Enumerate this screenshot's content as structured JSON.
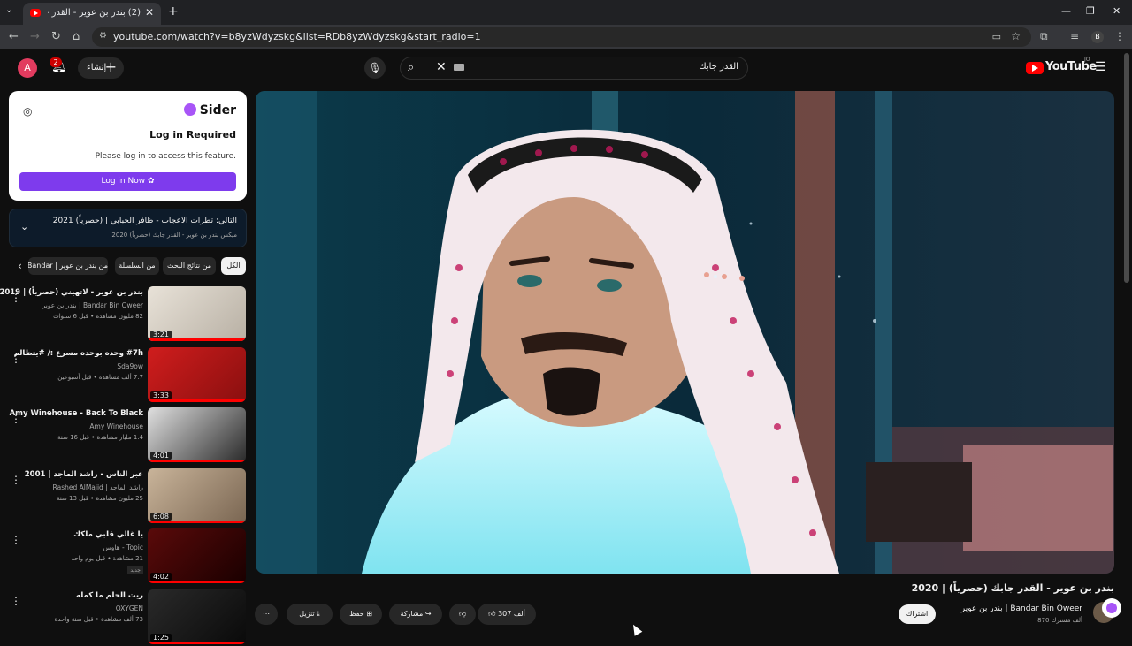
{
  "browser": {
    "tab_title": "(2) بندر بن عوير - القدر جابك (حصرياً) | 2020 - YouTube",
    "url": "youtube.com/watch?v=b8yzWdyzskg&list=RDb8yzWdyzskg&start_radio=1",
    "profile_initial": "B"
  },
  "header": {
    "avatar_initial": "A",
    "notif_count": "2",
    "create_label": "إنشاء",
    "search_query": "القدر جابك",
    "logo_text": "YouTube",
    "logo_region": "JO"
  },
  "sider": {
    "brand": "Sider",
    "title": "Log in Required",
    "message": "Please log in to access this feature.",
    "button": "Log in Now"
  },
  "playlist": {
    "now_playing": "التالي: تطرات الاعجاب - ظافر الحبابي | (حصرياً) 2021",
    "subtitle": "ميكس بندر بن عوير - القدر جابك (حصرياً) 2020"
  },
  "chips": [
    "الكل",
    "من نتائج البحث",
    "من السلسلة",
    "من بندر بن عوير | Bandar"
  ],
  "recommendations": [
    {
      "title": "بندر بن عوير - لاتهيني (حصرياً) | 2019",
      "channel": "بندر بن عوير | Bandar Bin Oweer",
      "meta": "82 مليون مشاهدة • قبل 6 سنوات",
      "duration": "3:21",
      "thumb_colors": [
        "#e8e2d8",
        "#b8b0a4"
      ]
    },
    {
      "title": "#7h وحده بوحده مسرع :/ #يتظالم",
      "channel": "Sda9ow",
      "meta": "7.7 ألف مشاهدة • قبل أسبوعين",
      "duration": "3:33",
      "thumb_colors": [
        "#d01d1d",
        "#8a0f0f"
      ]
    },
    {
      "title": "Amy Winehouse - Back To Black",
      "channel": "Amy Winehouse",
      "meta": "1.4 مليار مشاهدة • قبل 16 سنة",
      "duration": "4:01",
      "thumb_colors": [
        "#e0e0e0",
        "#2a2a2a"
      ]
    },
    {
      "title": "عبر الناس - راشد الماجد | 2001",
      "channel": "Rashed AlMajid | راشد الماجد",
      "meta": "25 مليون مشاهدة • قبل 13 سنة",
      "duration": "6:08",
      "thumb_colors": [
        "#c9b49a",
        "#7a6652"
      ]
    },
    {
      "title": "يا غالي قلبي ملكك",
      "channel": "هاوس - Topic",
      "meta": "21 مشاهدة • قبل يوم واحد",
      "duration": "4:02",
      "thumb_colors": [
        "#5a0a0a",
        "#1a0000"
      ],
      "badge": "جديد"
    },
    {
      "title": "ريت الحلم ما كمله",
      "channel": "OXYGEN",
      "meta": "73 ألف مشاهدة • قبل سنة واحدة",
      "duration": "1:25",
      "thumb_colors": [
        "#2a2a2a",
        "#0a0a0a"
      ]
    }
  ],
  "video": {
    "title": "بندر بن عوير - القدر جابك (حصرياً) | 2020",
    "channel": "بندر بن عوير | Bandar Bin Oweer",
    "subscribers": "870 ألف مشترك",
    "subscribe_label": "اشتراك",
    "likes": "307 ألف",
    "share_label": "مشاركة",
    "save_label": "حفظ",
    "download_label": "تنزيل"
  }
}
